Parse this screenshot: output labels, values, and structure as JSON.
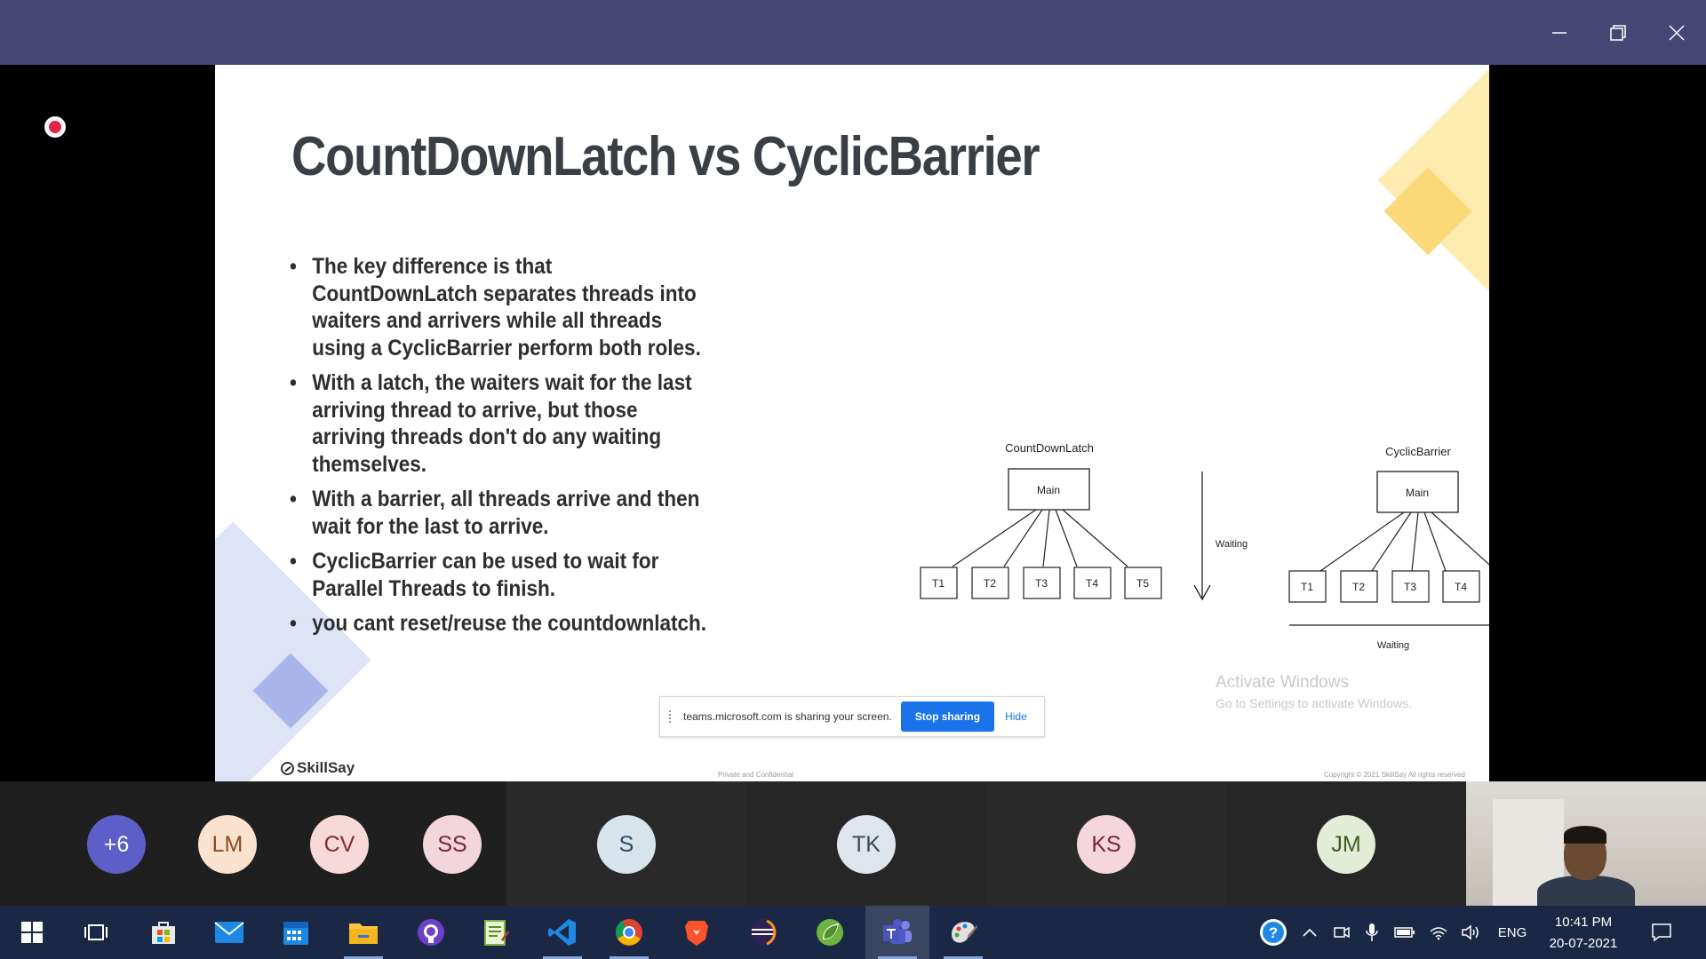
{
  "window": {
    "controls": [
      "minimize",
      "restore",
      "close"
    ]
  },
  "slide": {
    "title": "CountDownLatch vs CyclicBarrier",
    "bullets": [
      "The key difference is that CountDownLatch separates threads into waiters and arrivers while all threads using a CyclicBarrier perform both roles.",
      "With a latch, the waiters wait for the last arriving thread to arrive, but those arriving threads don't do any waiting themselves.",
      "With a barrier, all threads arrive and then wait for the last to arrive.",
      "CyclicBarrier can be used to wait for Parallel Threads to finish.",
      "you cant reset/reuse the countdownlatch."
    ],
    "diagram": {
      "left_title": "CountDownLatch",
      "right_title": "CyclicBarrier",
      "main_label": "Main",
      "threads": [
        "T1",
        "T2",
        "T3",
        "T4",
        "T5"
      ],
      "waiting_label": "Waiting"
    },
    "brand": "SkillSay",
    "footer_mid": "Private and Confidential",
    "footer_right": "Copyright © 2021 SkillSay All rights reserved",
    "activate_title": "Activate Windows",
    "activate_sub": "Go to Settings to activate Windows."
  },
  "share_bar": {
    "text": "teams.microsoft.com is sharing your screen.",
    "stop_label": "Stop sharing",
    "hide_label": "Hide"
  },
  "participants": [
    {
      "initials": "+6",
      "bg": "#5b5fc7",
      "fg": "#ffffff"
    },
    {
      "initials": "LM",
      "bg": "#fbe2cf",
      "fg": "#8a4b1f"
    },
    {
      "initials": "CV",
      "bg": "#f7d9d9",
      "fg": "#8b2a2a"
    },
    {
      "initials": "SS",
      "bg": "#f2d6dc",
      "fg": "#7a2437"
    },
    {
      "initials": "S",
      "bg": "#d7e4ec",
      "fg": "#2d4b61"
    },
    {
      "initials": "TK",
      "bg": "#dfe5ec",
      "fg": "#3b4754"
    },
    {
      "initials": "KS",
      "bg": "#f6d6dd",
      "fg": "#7d2235"
    },
    {
      "initials": "JM",
      "bg": "#e3ecd6",
      "fg": "#3f5a23"
    }
  ],
  "taskbar": {
    "apps": [
      "windows-start",
      "task-view",
      "microsoft-store",
      "mail",
      "calendar",
      "file-explorer",
      "github-desktop",
      "notepad-plus-plus",
      "visual-studio-code",
      "chrome",
      "brave",
      "eclipse",
      "spring-tool-suite",
      "microsoft-teams",
      "paint"
    ],
    "active_app": "microsoft-teams",
    "language": "ENG",
    "time": "10:41 PM",
    "date": "20-07-2021"
  }
}
